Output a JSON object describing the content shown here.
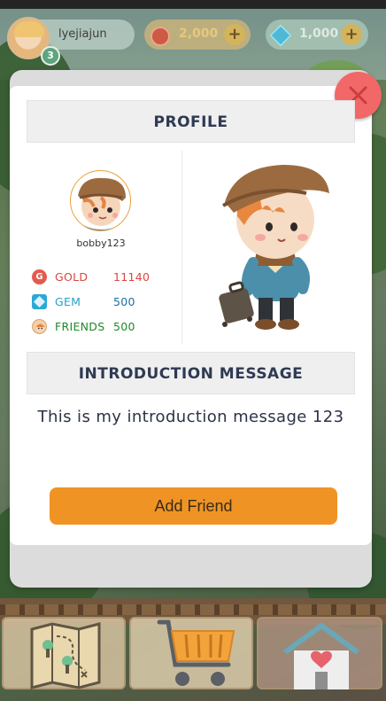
{
  "hud": {
    "username": "lyejiajun",
    "level": "3",
    "gold_amount": "2,000",
    "gem_amount": "1,000",
    "plus_label": "+"
  },
  "profile": {
    "title": "PROFILE",
    "username": "bobby123",
    "stats": {
      "gold": {
        "icon_letter": "G",
        "label": "GOLD",
        "value": "11140",
        "color": "#d9473e"
      },
      "gem": {
        "label": "GEM",
        "value": "500",
        "color": "#27a0c6"
      },
      "friends": {
        "label": "FRIENDS",
        "value": "500",
        "color": "#1e8a2a"
      }
    }
  },
  "introduction": {
    "title": "INTRODUCTION MESSAGE",
    "message": "This is my introduction message 123"
  },
  "actions": {
    "add_friend_label": "Add Friend",
    "close_icon": "close-icon"
  },
  "bottom_nav": {
    "items": [
      "map-icon",
      "shop-cart-icon",
      "home-heart-icon"
    ]
  },
  "colors": {
    "accent": "#ef9424",
    "close": "#f26767",
    "header_bg": "#efefef"
  }
}
